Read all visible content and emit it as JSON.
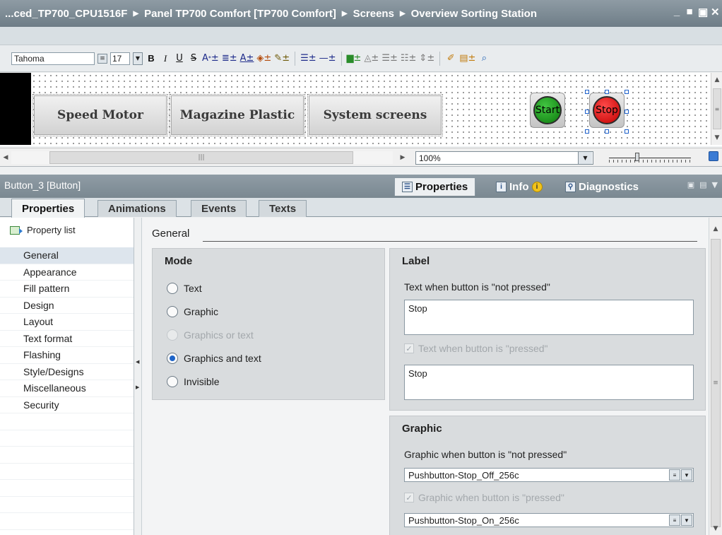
{
  "window": {
    "breadcrumbs": [
      "...ced_TP700_CPU1516F",
      "Panel TP700 Comfort [TP700 Comfort]",
      "Screens",
      "Overview Sorting Station"
    ],
    "controls": [
      "_",
      "■",
      "▣",
      "✕"
    ]
  },
  "toolbar": {
    "font_name": "Tahoma",
    "font_size": "17",
    "bold": "B",
    "italic": "I",
    "underline": "U",
    "strike": "S"
  },
  "canvas": {
    "buttons": [
      {
        "label": "Speed Motor"
      },
      {
        "label": "Magazine Plastic"
      },
      {
        "label": "System screens"
      }
    ],
    "start_label": "Start",
    "stop_label": "Stop",
    "zoom": "100%"
  },
  "inspector": {
    "object_title": "Button_3 [Button]",
    "tabs": [
      "Properties",
      "Info",
      "Diagnostics"
    ],
    "subtabs": [
      "Properties",
      "Animations",
      "Events",
      "Texts"
    ]
  },
  "left_list": {
    "header": "Property list",
    "items": [
      "General",
      "Appearance",
      "Fill pattern",
      "Design",
      "Layout",
      "Text format",
      "Flashing",
      "Style/Designs",
      "Miscellaneous",
      "Security"
    ]
  },
  "general": {
    "heading": "General",
    "mode": {
      "title": "Mode",
      "options": [
        "Text",
        "Graphic",
        "Graphics or text",
        "Graphics and text",
        "Invisible"
      ],
      "selected": "Graphics and text"
    },
    "label": {
      "title": "Label",
      "not_pressed_label": "Text when button is \"not pressed\"",
      "not_pressed_value": "Stop",
      "pressed_label": "Text when button is \"pressed\"",
      "pressed_value": "Stop"
    },
    "graphic": {
      "title": "Graphic",
      "not_pressed_label": "Graphic when button is \"not pressed\"",
      "not_pressed_value": "Pushbutton-Stop_Off_256c",
      "pressed_label": "Graphic when button is \"pressed\"",
      "pressed_value": "Pushbutton-Stop_On_256c"
    }
  },
  "colors": {
    "title_bar": "#7a8891",
    "start_green": "#1f9a1f",
    "stop_red": "#e01010",
    "selection_blue": "#1c5fc9"
  }
}
